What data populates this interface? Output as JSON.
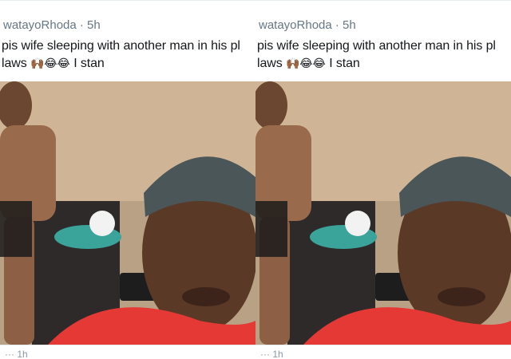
{
  "tweets": [
    {
      "meta": "watayoRhoda · 5h",
      "line1": "pis wife sleeping with another man in his pl",
      "line2_text": "laws",
      "line2_emojis": "🙌🏾😂😂",
      "line2_tail": "I stan",
      "footer": "··· 1h"
    },
    {
      "meta": "watayoRhoda · 5h",
      "line1": "pis wife sleeping with another man in his pl",
      "line2_text": "laws",
      "line2_emojis": "🙌🏾😂😂",
      "line2_tail": "I stan",
      "footer": "··· 1h"
    }
  ],
  "icons": [
    "video-frame"
  ],
  "colors": {
    "text": "#14171a",
    "muted": "#657786",
    "shirt": "#e53935",
    "beanie": "#4a5658",
    "bucket": "#3aa39a"
  }
}
